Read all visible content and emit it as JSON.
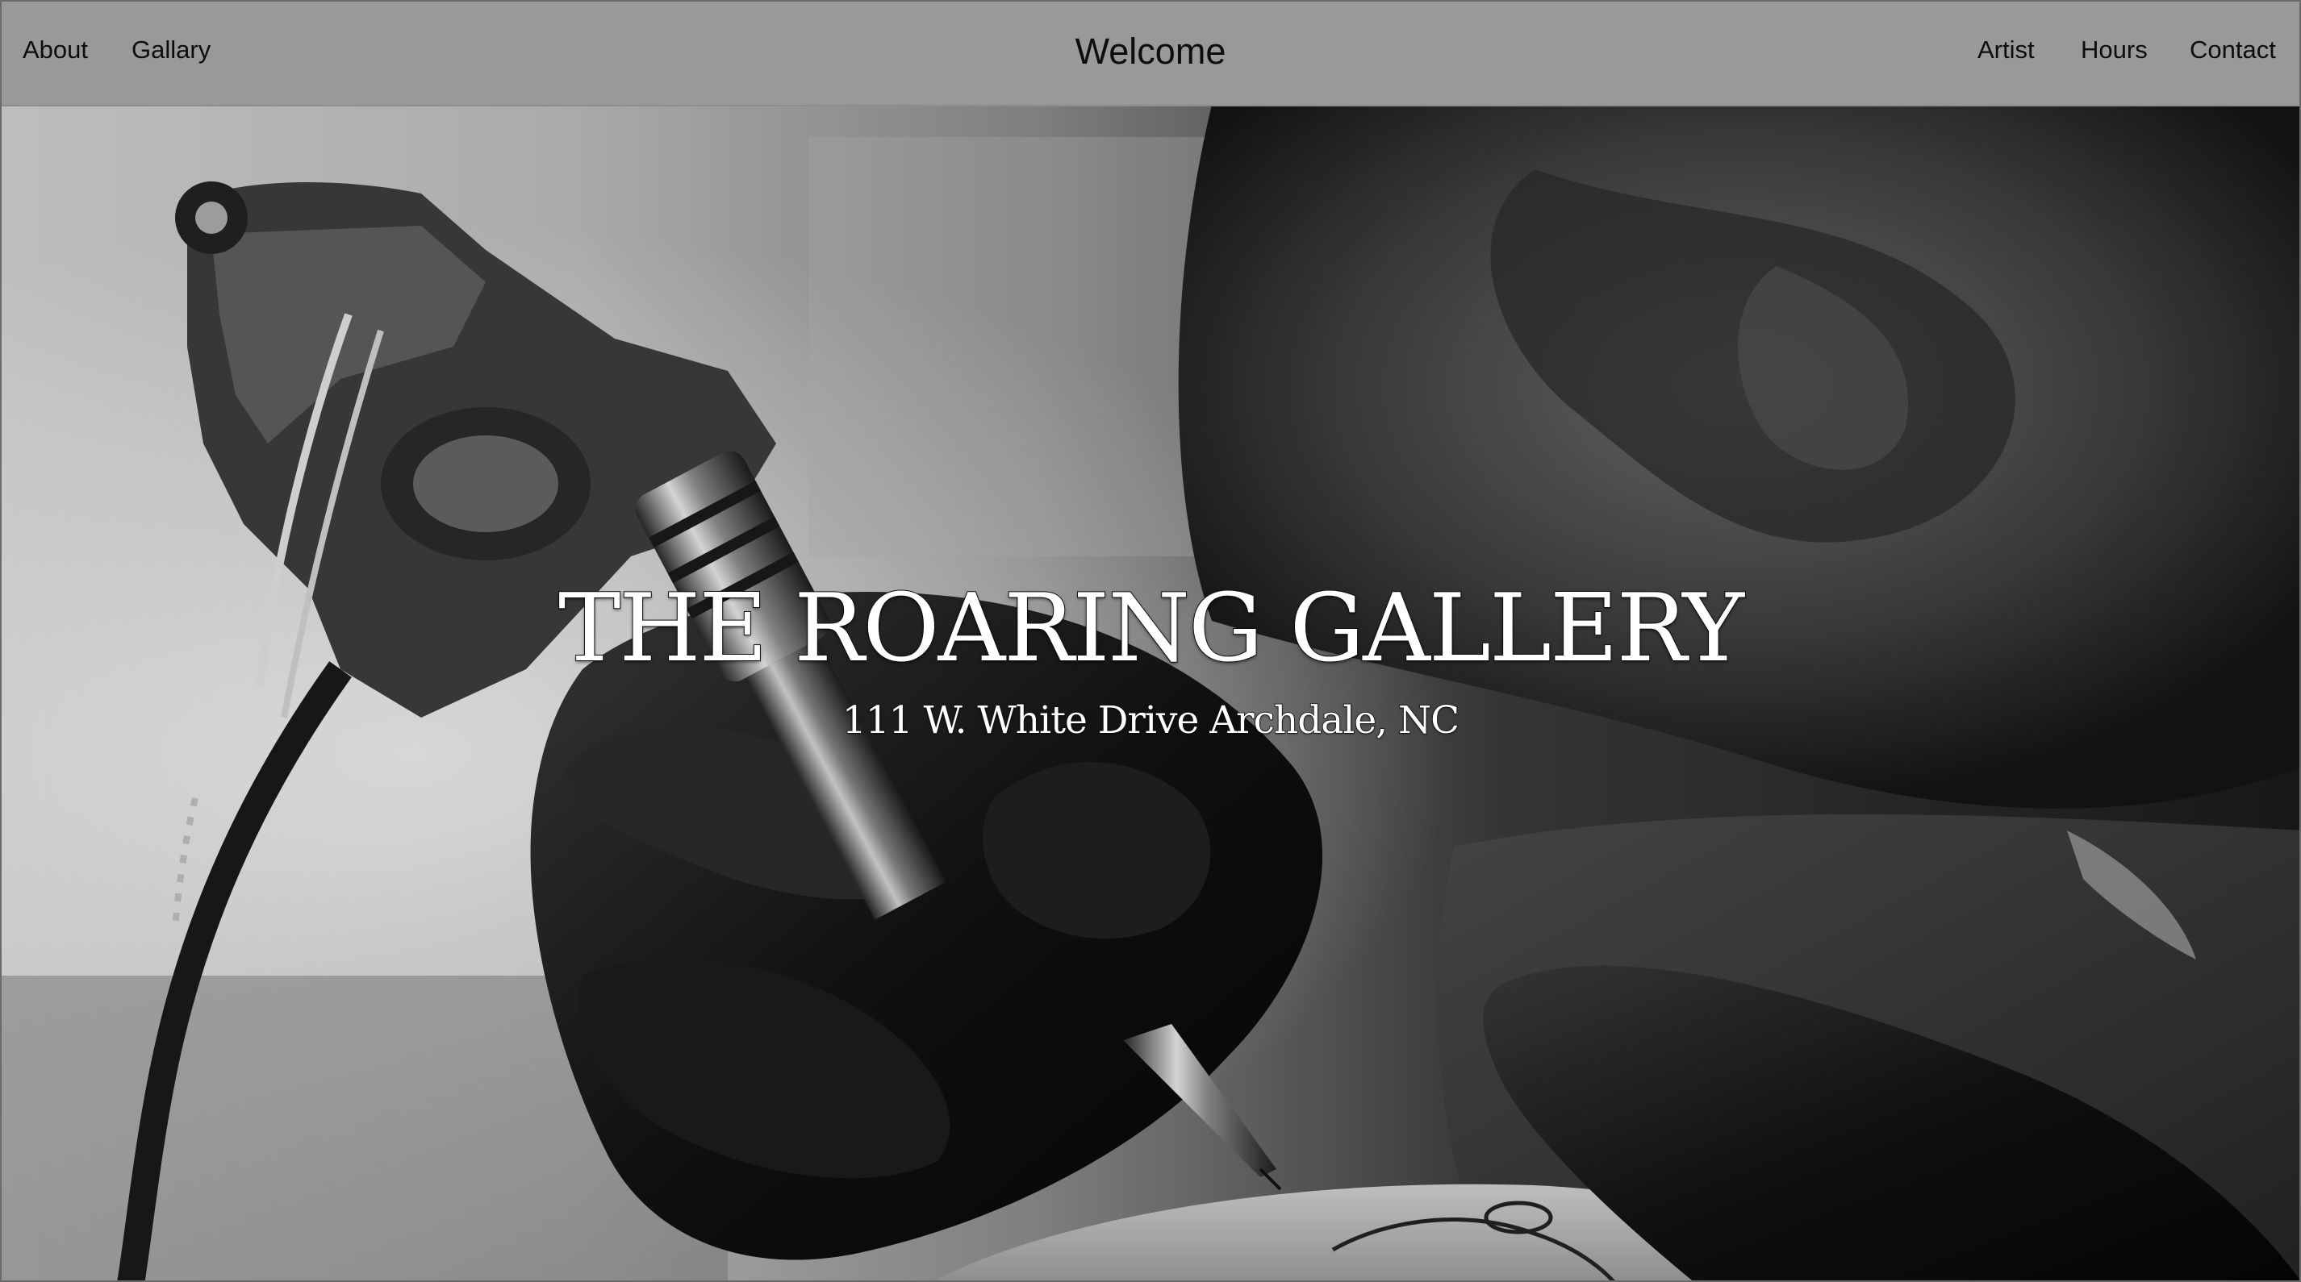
{
  "navbar": {
    "left_links": [
      "About",
      "Gallary"
    ],
    "title": "Welcome",
    "right_links": [
      "Artist",
      "Hours",
      "Contact"
    ]
  },
  "hero": {
    "title": "THE ROARING GALLERY",
    "address": "111 W. White Drive Archdale, NC",
    "image": "tattoo-artist-black-and-white-photo"
  }
}
